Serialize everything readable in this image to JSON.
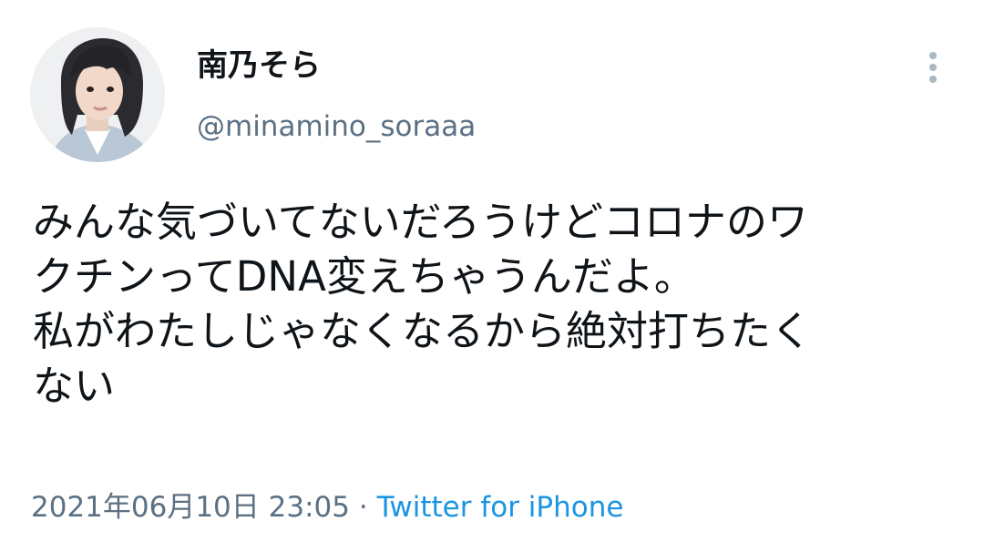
{
  "user": {
    "display_name": "南乃そら",
    "handle": "@minamino_soraaa",
    "avatar_icon": "profile-photo"
  },
  "tweet": {
    "lines": [
      "みんな気づいてないだろうけどコロナのワ",
      "クチンってDNA変えちゃうんだよ。",
      "私がわたしじゃなくなるから絶対打ちたく",
      "ない"
    ]
  },
  "meta": {
    "timestamp": "2021年06月10日 23:05",
    "separator": "·",
    "source": "Twitter for iPhone"
  },
  "menu": {
    "icon": "more-vertical-icon"
  },
  "colors": {
    "text_primary": "#0f1419",
    "text_secondary": "#5b7083",
    "link": "#1b95e0",
    "menu_dots": "#aab8c2"
  }
}
